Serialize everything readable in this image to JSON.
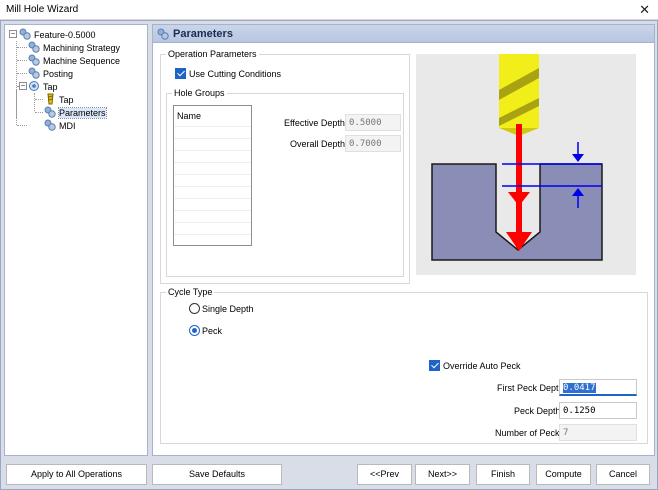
{
  "window": {
    "title": "Mill Hole Wizard",
    "close_glyph": "✕"
  },
  "tree": {
    "root": "Feature-0.5000",
    "children": [
      "Machining Strategy",
      "Machine Sequence",
      "Posting",
      "Tap"
    ],
    "tap_children": [
      "Tap",
      "Parameters"
    ],
    "last": "MDI",
    "selected": "Parameters",
    "collapse_glyph": "−"
  },
  "panel": {
    "title": "Parameters",
    "operation_parameters": {
      "label": "Operation Parameters",
      "use_cutting_conditions": {
        "label": "Use Cutting Conditions",
        "checked": true
      }
    },
    "hole_groups": {
      "label": "Hole Groups",
      "column_header": "Name",
      "effective_depth": {
        "label": "Effective Depth",
        "value": "0.5000"
      },
      "overall_depth": {
        "label": "Overall Depth",
        "value": "0.7000"
      }
    },
    "cycle_type": {
      "label": "Cycle Type",
      "options": [
        "Single Depth",
        "Peck"
      ],
      "selected": "Peck",
      "override_auto_peck": {
        "label": "Override Auto Peck",
        "checked": true
      },
      "first_peck_depth": {
        "label": "First Peck Depth",
        "value": "0.0417"
      },
      "peck_depth": {
        "label": "Peck Depth",
        "value": "0.1250"
      },
      "number_of_pecks": {
        "label": "Number of Pecks",
        "value": "7"
      }
    }
  },
  "buttons": {
    "apply_all": "Apply to All Operations",
    "save_defaults": "Save Defaults",
    "prev": "<<Prev",
    "next": "Next>>",
    "finish": "Finish",
    "compute": "Compute",
    "cancel": "Cancel"
  },
  "colors": {
    "accent": "#1e64c8",
    "drill_yellow": "#f2ee1a",
    "arrow_red": "#ff0000",
    "part_purple": "#8a8db5",
    "marker_blue": "#0000ee"
  }
}
